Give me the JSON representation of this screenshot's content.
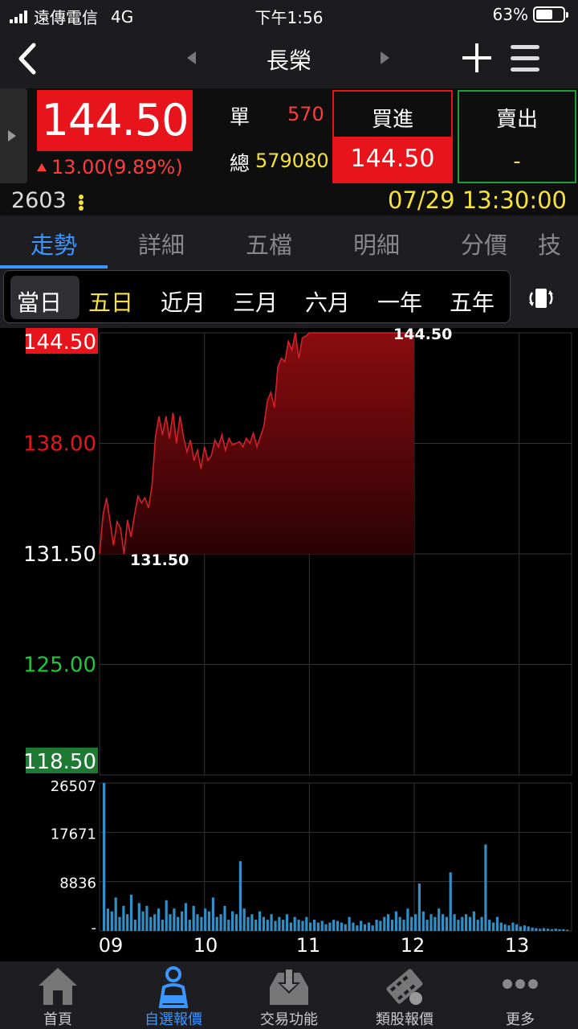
{
  "status_bar": {
    "carrier": "遠傳電信",
    "network": "4G",
    "time": "下午1:56",
    "battery": "63%",
    "battery_level": 0.63
  },
  "nav": {
    "title": "長榮",
    "back_icon": "chevron-left-icon",
    "prev_icon": "triangle-left-icon",
    "next_icon": "triangle-right-icon",
    "add_icon": "plus-icon",
    "menu_icon": "hamburger-menu-icon"
  },
  "quote": {
    "price": "144.50",
    "change": "13.00",
    "change_pct": "(9.89%)",
    "single_label": "單",
    "single_volume": "570",
    "total_label": "總",
    "total_volume": "579080",
    "buy_label": "買進",
    "buy_price": "144.50",
    "sell_label": "賣出",
    "sell_price": "-",
    "stock_code": "2603",
    "datetime": "07/29 13:30:00"
  },
  "tabs": [
    "走勢",
    "詳細",
    "五檔",
    "明細",
    "分價",
    "技"
  ],
  "periods": [
    "當日",
    "五日",
    "近月",
    "三月",
    "六月",
    "一年",
    "五年"
  ],
  "colors": {
    "up": "#e8141b",
    "down": "#1e9e3a",
    "accent": "#3a97ff",
    "highlight": "#f5e23b"
  },
  "chart_data": {
    "type": "area",
    "price_axis_ticks": [
      "144.50",
      "138.00",
      "131.50",
      "125.00",
      "118.50"
    ],
    "ylim": [
      118.5,
      144.5
    ],
    "high_label": "144.50",
    "low_label": "131.50",
    "time_axis_ticks": [
      "09",
      "10",
      "11",
      "12",
      "13"
    ],
    "volume_axis_ticks": [
      "26507",
      "17671",
      "8836",
      "-"
    ],
    "volume_max": 26507,
    "price_series": [
      [
        0,
        131.5
      ],
      [
        2,
        133.8
      ],
      [
        4,
        134.8
      ],
      [
        6,
        133.4
      ],
      [
        8,
        132.0
      ],
      [
        10,
        133.4
      ],
      [
        12,
        133.0
      ],
      [
        14,
        131.5
      ],
      [
        16,
        133.5
      ],
      [
        18,
        132.5
      ],
      [
        20,
        133.8
      ],
      [
        22,
        134.9
      ],
      [
        24,
        134.5
      ],
      [
        26,
        134.8
      ],
      [
        28,
        134.2
      ],
      [
        30,
        135.5
      ],
      [
        32,
        138.4
      ],
      [
        34,
        139.6
      ],
      [
        36,
        138.5
      ],
      [
        38,
        139.6
      ],
      [
        40,
        138.3
      ],
      [
        42,
        139.8
      ],
      [
        44,
        138.0
      ],
      [
        46,
        139.6
      ],
      [
        48,
        138.4
      ],
      [
        50,
        137.5
      ],
      [
        52,
        138.2
      ],
      [
        54,
        137.0
      ],
      [
        56,
        137.6
      ],
      [
        58,
        136.5
      ],
      [
        60,
        137.8
      ],
      [
        62,
        137.0
      ],
      [
        64,
        137.3
      ],
      [
        66,
        138.2
      ],
      [
        68,
        137.8
      ],
      [
        70,
        138.5
      ],
      [
        72,
        137.6
      ],
      [
        74,
        138.3
      ],
      [
        76,
        137.9
      ],
      [
        78,
        138.0
      ],
      [
        80,
        138.1
      ],
      [
        82,
        137.8
      ],
      [
        84,
        138.3
      ],
      [
        86,
        138.0
      ],
      [
        88,
        138.6
      ],
      [
        90,
        137.8
      ],
      [
        92,
        138.4
      ],
      [
        94,
        139.0
      ],
      [
        96,
        140.5
      ],
      [
        98,
        141.0
      ],
      [
        100,
        140.1
      ],
      [
        102,
        142.5
      ],
      [
        104,
        143.0
      ],
      [
        106,
        142.8
      ],
      [
        108,
        144.0
      ],
      [
        110,
        143.5
      ],
      [
        112,
        144.5
      ],
      [
        114,
        143.0
      ],
      [
        116,
        144.2
      ],
      [
        118,
        144.3
      ],
      [
        120,
        144.5
      ],
      [
        124,
        144.5
      ],
      [
        130,
        144.5
      ],
      [
        140,
        144.5
      ],
      [
        150,
        144.5
      ],
      [
        160,
        144.5
      ],
      [
        170,
        144.5
      ],
      [
        180,
        144.5
      ]
    ],
    "session_minutes": 270,
    "volume_series": [
      26507,
      4000,
      3500,
      6000,
      2500,
      4500,
      3000,
      6500,
      2000,
      5000,
      3500,
      4500,
      2500,
      3000,
      4000,
      2000,
      5500,
      3000,
      4000,
      2500,
      3500,
      5000,
      2000,
      4500,
      3000,
      2500,
      4000,
      3500,
      6000,
      2500,
      3000,
      4500,
      2000,
      3500,
      3000,
      12500,
      4000,
      2500,
      3000,
      2000,
      3500,
      2500,
      2000,
      3000,
      1800,
      2500,
      2000,
      3000,
      1500,
      2500,
      2000,
      1800,
      2500,
      1500,
      2000,
      1500,
      1800,
      1200,
      1500,
      2000,
      1800,
      1500,
      1200,
      2500,
      1500,
      1000,
      1800,
      1200,
      1500,
      1000,
      2000,
      1800,
      2500,
      3000,
      2000,
      3500,
      2500,
      2000,
      4000,
      2500,
      3000,
      8500,
      3500,
      2000,
      3000,
      2500,
      4000,
      3000,
      2500,
      10500,
      3000,
      2000,
      2500,
      3000,
      2500,
      3500,
      2000,
      2500,
      15500,
      2000,
      1500,
      2500,
      1500,
      1200,
      1000,
      1500,
      1200,
      800,
      1000,
      800,
      600,
      500,
      400,
      500,
      400,
      300,
      400,
      300,
      300,
      200
    ]
  },
  "bottom_nav": [
    {
      "label": "首頁",
      "icon": "home-icon"
    },
    {
      "label": "自選報價",
      "icon": "watchlist-icon"
    },
    {
      "label": "交易功能",
      "icon": "trade-tray-icon"
    },
    {
      "label": "類股報價",
      "icon": "sector-film-icon"
    },
    {
      "label": "更多",
      "icon": "more-dots-icon"
    }
  ]
}
